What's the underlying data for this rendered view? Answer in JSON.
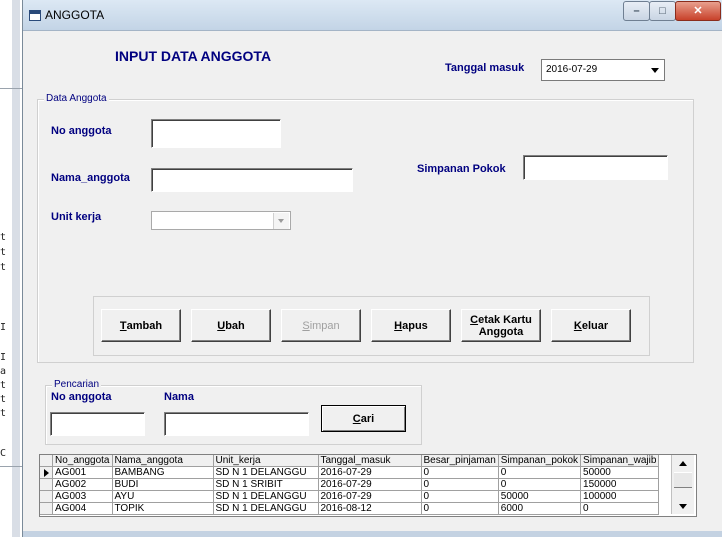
{
  "window": {
    "title": "ANGGOTA"
  },
  "form": {
    "heading": "INPUT DATA ANGGOTA",
    "tanggal_masuk_label": "Tanggal masuk",
    "tanggal_masuk_value": "2016-07-29",
    "frame_caption": "Data Anggota",
    "no_anggota_label": "No anggota",
    "nama_anggota_label": "Nama_anggota",
    "unit_kerja_label": "Unit kerja",
    "simpanan_pokok_label": "Simpanan Pokok",
    "no_anggota_value": "",
    "nama_anggota_value": "",
    "simpanan_pokok_value": "",
    "unit_kerja_value": ""
  },
  "buttons": {
    "tambah": {
      "hotkey": "T",
      "rest": "ambah"
    },
    "ubah": {
      "hotkey": "U",
      "rest": "bah"
    },
    "simpan": {
      "hotkey": "S",
      "rest": "impan"
    },
    "hapus": {
      "hotkey": "H",
      "rest": "apus"
    },
    "cetak_line1_hotkey": "C",
    "cetak_line1_rest": "etak Kartu",
    "cetak_line2": "Anggota",
    "keluar": {
      "hotkey": "K",
      "rest": "eluar"
    }
  },
  "search": {
    "caption": "Pencarian",
    "no_anggota_label": "No anggota",
    "nama_label": "Nama",
    "no_anggota_value": "",
    "nama_value": "",
    "cari_hotkey": "C",
    "cari_rest": "ari"
  },
  "grid": {
    "columns": [
      "No_anggota",
      "Nama_anggota",
      "Unit_kerja",
      "Tanggal_masuk",
      "Besar_pinjaman",
      "Simpanan_pokok",
      "Simpanan_wajib"
    ],
    "rows": [
      [
        "AG001",
        "BAMBANG",
        "SD N 1 DELANGGU",
        "2016-07-29",
        "0",
        "0",
        "50000"
      ],
      [
        "AG002",
        "BUDI",
        "SD N 1 SRIBIT",
        "2016-07-29",
        "0",
        "0",
        "150000"
      ],
      [
        "AG003",
        "AYU",
        "SD N 1 DELANGGU",
        "2016-07-29",
        "0",
        "50000",
        "100000"
      ],
      [
        "AG004",
        "TOPIK",
        "SD N 1 DELANGGU",
        "2016-08-12",
        "0",
        "6000",
        "0"
      ]
    ]
  },
  "background": {
    "left_chars": [
      "t",
      "t",
      "t",
      "I",
      "I",
      "a",
      "t",
      "t",
      "t",
      "C"
    ]
  },
  "colors": {
    "label_color": "#000080",
    "face": "#f0f0f0",
    "close_button": "#c8412a"
  }
}
